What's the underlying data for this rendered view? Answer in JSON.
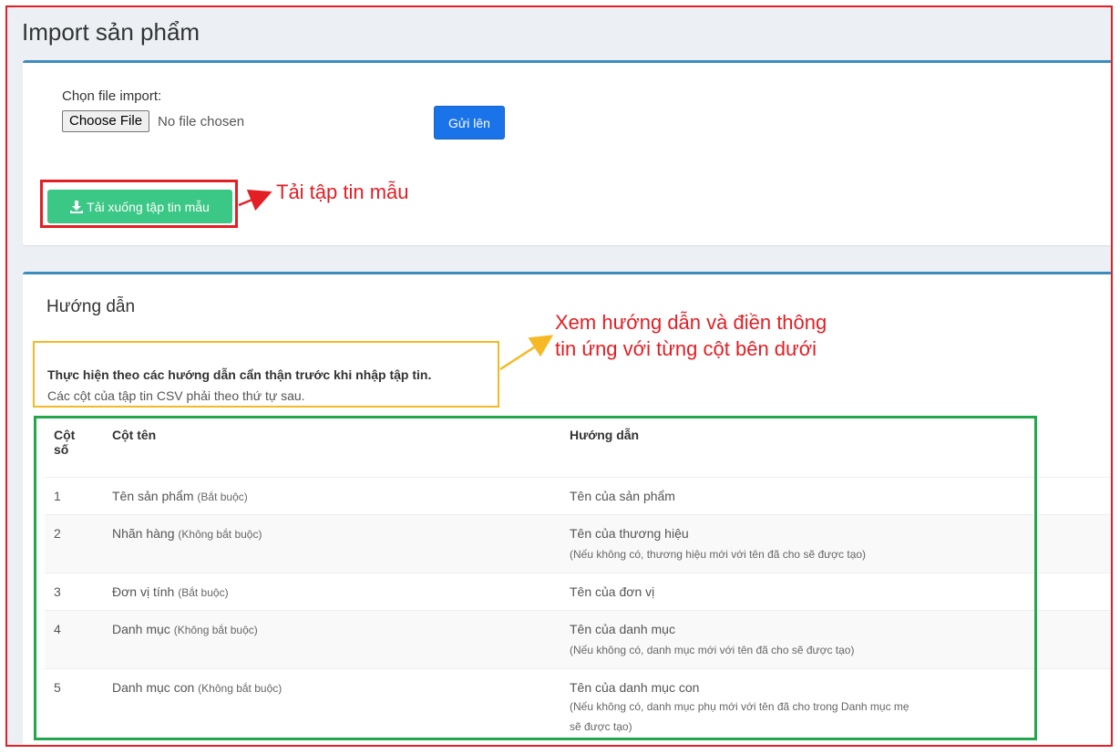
{
  "page": {
    "title": "Import sản phẩm"
  },
  "upload": {
    "label": "Chọn file import:",
    "choose_button": "Choose File",
    "file_status": "No file chosen",
    "submit_label": "Gửi lên",
    "download_label": "Tải xuống tập tin mẫu",
    "submit_color": "#1a73e8",
    "download_color": "#3bc785"
  },
  "guide": {
    "title": "Hướng dẫn",
    "intro_strong": "Thực hiện theo các hướng dẫn cẩn thận trước khi nhập tập tin.",
    "intro_sub": "Các cột của tập tin CSV phải theo thứ tự sau.",
    "columns": {
      "no_line1": "Cột",
      "no_line2": "số",
      "name": "Cột tên",
      "instruction": "Hướng dẫn"
    },
    "rows": [
      {
        "no": "1",
        "name": "Tên sản phẩm",
        "req": "(Bắt buộc)",
        "instruction": "Tên của sản phẩm",
        "note": ""
      },
      {
        "no": "2",
        "name": "Nhãn hàng",
        "req": "(Không bắt buộc)",
        "instruction": "Tên của thương hiệu",
        "note": "(Nếu không có, thương hiệu mới với tên đã cho sẽ được tạo)"
      },
      {
        "no": "3",
        "name": "Đơn vị tính",
        "req": "(Bắt buộc)",
        "instruction": "Tên của đơn vị",
        "note": ""
      },
      {
        "no": "4",
        "name": "Danh mục",
        "req": "(Không bắt buộc)",
        "instruction": "Tên của danh mục",
        "note": "(Nếu không có, danh mục mới với tên đã cho sẽ được tạo)"
      },
      {
        "no": "5",
        "name": "Danh mục con",
        "req": "(Không bắt buộc)",
        "instruction": "Tên của danh mục con",
        "note_line1": "(Nếu không có, danh mục phụ mới với tên đã cho trong Danh mục mẹ",
        "note_line2": "sẽ được tạo)"
      }
    ]
  },
  "annotations": {
    "download_hint": "Tải tập tin mẫu",
    "guide_hint_line1": "Xem hướng dẫn và điền thông",
    "guide_hint_line2": "tin ứng với từng cột bên dưới",
    "red": "#e31e24",
    "yellow": "#f5b925",
    "green": "#22a74a"
  },
  "icons": {
    "download": "download-icon"
  }
}
